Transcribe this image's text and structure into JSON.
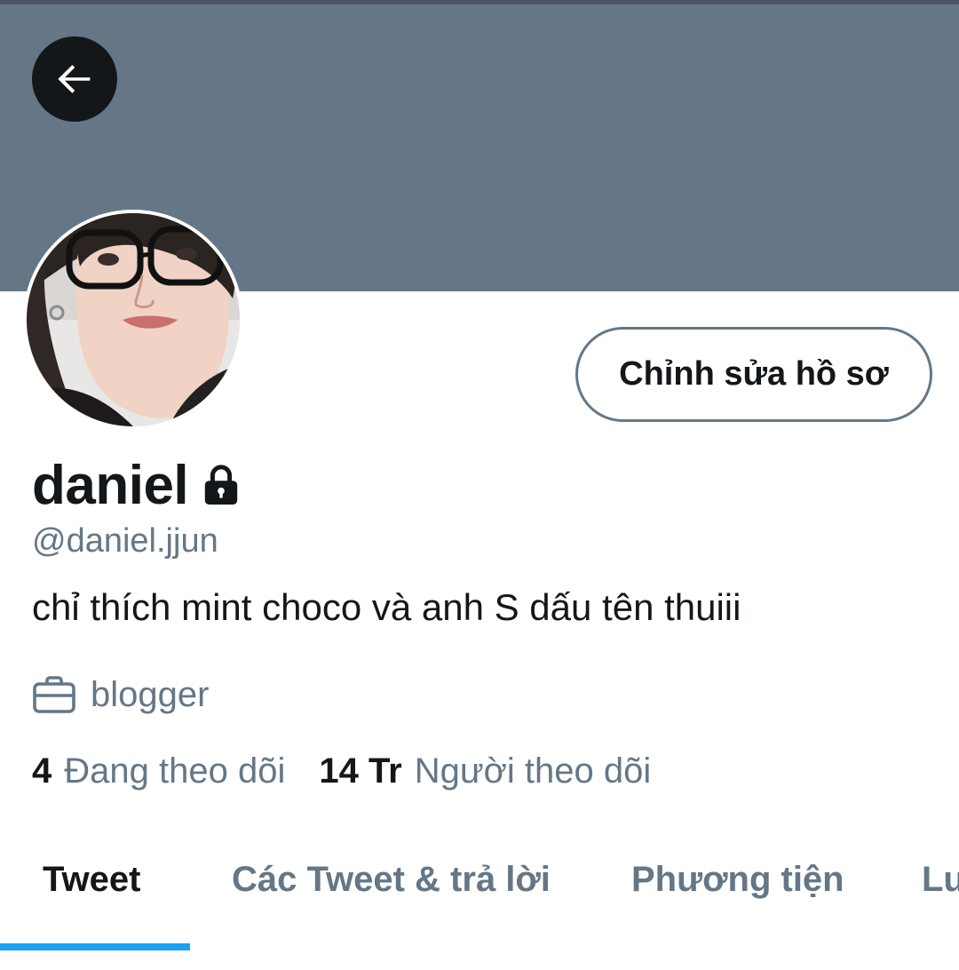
{
  "profile": {
    "display_name": "daniel",
    "handle": "@daniel.jjun",
    "bio": "chỉ thích mint choco và anh S dấu tên thuiii",
    "job": "blogger",
    "protected": true
  },
  "actions": {
    "edit_profile": "Chỉnh sửa hồ sơ"
  },
  "stats": {
    "following_count": "4",
    "following_label": "Đang theo dõi",
    "followers_count": "14 Tr",
    "followers_label": "Người theo dõi"
  },
  "tabs": [
    {
      "label": "Tweet",
      "active": true
    },
    {
      "label": "Các Tweet & trả lời",
      "active": false
    },
    {
      "label": "Phương tiện",
      "active": false
    },
    {
      "label": "Lu",
      "active": false
    }
  ],
  "icons": {
    "back": "arrow-left-icon",
    "lock": "lock-icon",
    "job": "briefcase-icon"
  },
  "colors": {
    "banner": "#657786",
    "accent": "#1da1f2",
    "text_primary": "#14171a",
    "text_secondary": "#657786"
  }
}
